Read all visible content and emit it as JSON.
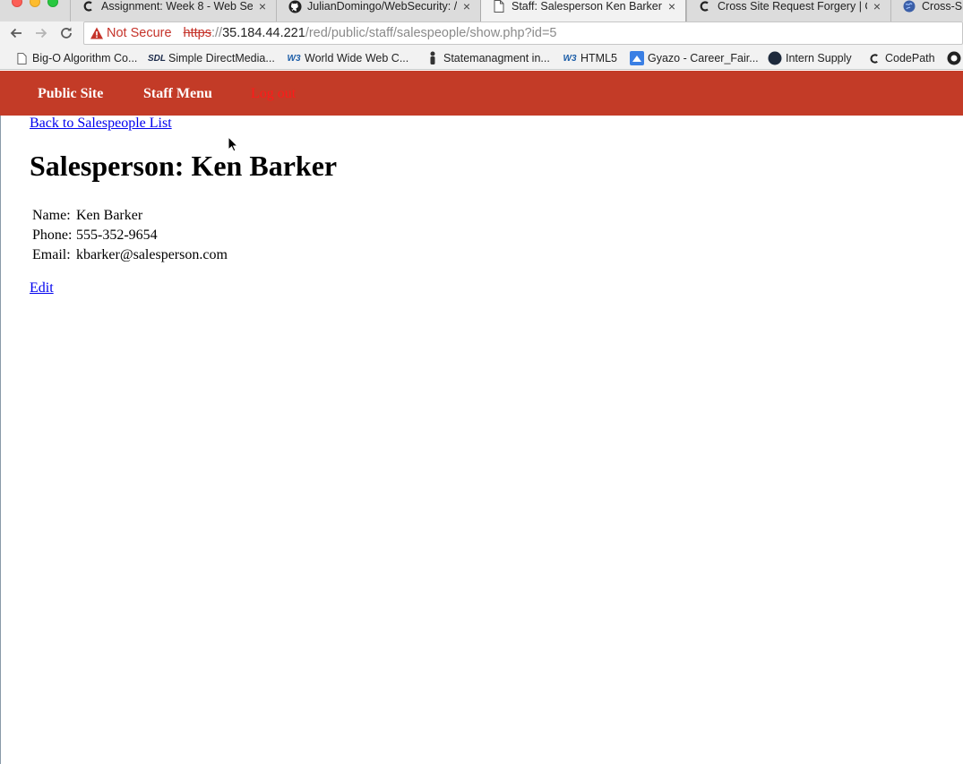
{
  "browser": {
    "tabs": [
      {
        "title": "Assignment: Week 8 - Web Se",
        "icon": "codepath-icon",
        "active": false
      },
      {
        "title": "JulianDomingo/WebSecurity: /",
        "icon": "github-icon",
        "active": false
      },
      {
        "title": "Staff: Salesperson Ken Barker",
        "icon": "document-icon",
        "active": true
      },
      {
        "title": "Cross Site Request Forgery | C",
        "icon": "codepath-icon",
        "active": false
      },
      {
        "title": "Cross-Sit",
        "icon": "globe-icon",
        "active": false
      }
    ],
    "close_glyph": "×",
    "address": {
      "security_label": "Not Secure",
      "protocol": "https",
      "separator": "://",
      "host": "35.184.44.221",
      "path": "/red/public/staff/salespeople/show.php?id=5"
    },
    "bookmarks": [
      {
        "label": "Big-O Algorithm Co...",
        "icon": "document-icon"
      },
      {
        "label": "Simple DirectMedia...",
        "icon": "sdl-icon",
        "icon_text": "SDL"
      },
      {
        "label": "World Wide Web C...",
        "icon": "w3c-icon",
        "icon_text": "W3"
      },
      {
        "label": "Statemanagment in...",
        "icon": "person-icon"
      },
      {
        "label": "HTML5",
        "icon": "w3c-icon",
        "icon_text": "W3"
      },
      {
        "label": "Gyazo - Career_Fair...",
        "icon": "gyazo-icon"
      },
      {
        "label": "Intern Supply",
        "icon": "circle-icon"
      },
      {
        "label": "CodePath",
        "icon": "codepath-icon"
      }
    ]
  },
  "site_nav": {
    "public_site": "Public Site",
    "staff_menu": "Staff Menu",
    "log_out": "Log out"
  },
  "page": {
    "back_link": "Back to Salespeople List",
    "title": "Salesperson: Ken Barker",
    "fields": [
      {
        "label": "Name:",
        "value": "Ken Barker"
      },
      {
        "label": "Phone:",
        "value": "555-352-9654"
      },
      {
        "label": "Email:",
        "value": "kbarker@salesperson.com"
      }
    ],
    "edit_link": "Edit"
  },
  "colors": {
    "header_bg": "#c33b27",
    "logout_red": "#ff1a1a",
    "link_blue": "#0000ee",
    "not_secure_red": "#c5332a"
  }
}
